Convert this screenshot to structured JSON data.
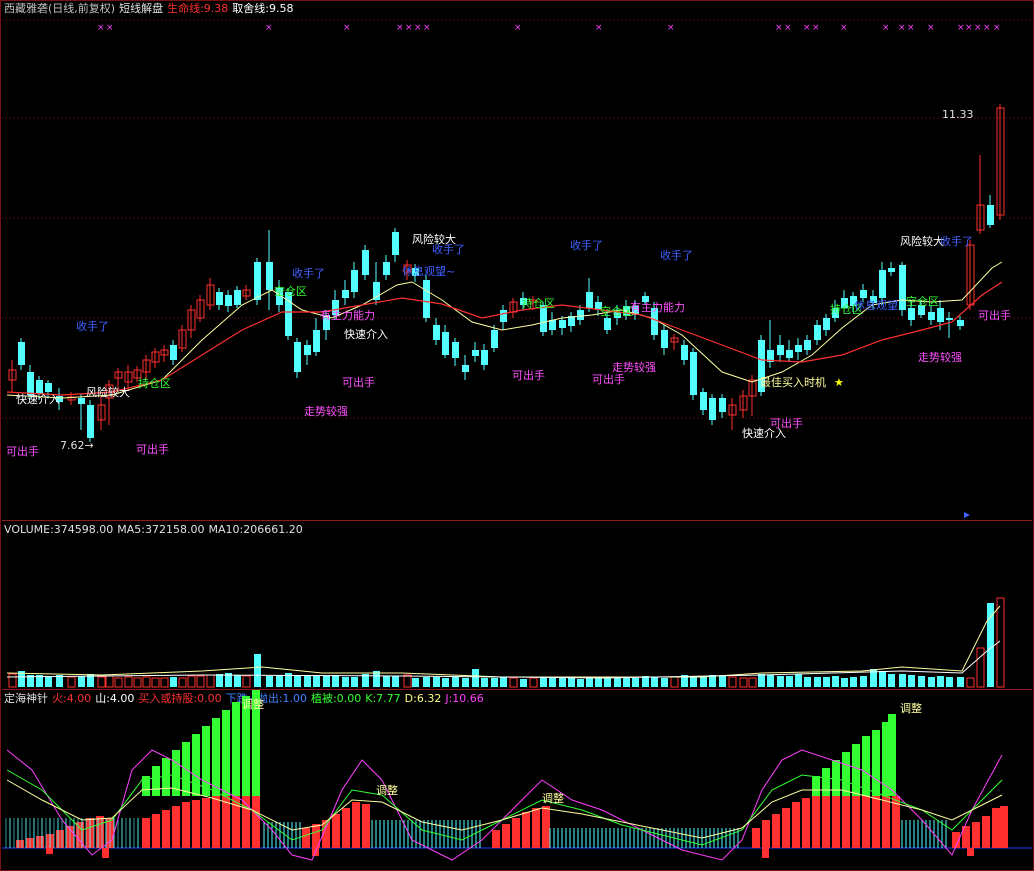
{
  "price_header": {
    "title": "西藏雅砻(日线,前复权)",
    "indicator": "短线解盘",
    "lifeline_label": "生命线:9.38",
    "exitline_label": "取舍线:9.58",
    "title_color": "#c0c0c0",
    "lifeline_color": "#ff3030",
    "exitline_color": "#ffffff"
  },
  "price_labels": {
    "high_marker": "11.33",
    "low_marker": "7.62→",
    "fast_entry": "快速介入",
    "risk_high": "风险较大",
    "take_profit": "收手了",
    "sellable": "可出手",
    "strong_trend": "走势较强",
    "hold_zone": "持仓区",
    "empty_zone": "空仓区",
    "wait_see": "休息观望~",
    "main_power": "有主力能力",
    "best_buy": "最佳买入时机",
    "best_buy_star": "★",
    "wait_see_b": "休息观望"
  },
  "volume_header": {
    "volume": "VOLUME:374598.00",
    "ma5": "MA5:372158.00",
    "ma10": "MA10:206661.20"
  },
  "osc_header": {
    "name": "定海神针",
    "fire": "火:4.00",
    "mountain": "山:4.00",
    "buy_hold": "买入或持股:0.00",
    "down_sell": "下跌→抛出:1.00",
    "plant": "植被:0.00",
    "k": "K:7.77",
    "d": "D:6.32",
    "j": "J:10.66"
  },
  "osc_labels": {
    "adjust": "调整"
  },
  "colors": {
    "up": "#ff3030",
    "down": "#54ffff",
    "ma_white": "#ffffa0",
    "ma_red": "#ff2020",
    "green_bar": "#33ff33",
    "magenta": "#ff40ff",
    "blue_text": "#4060ff",
    "pink_text": "#ff50ff"
  },
  "chart_data": {
    "type": "candlestick",
    "symbol": "西藏雅砻",
    "period": "日线",
    "high_label": 11.33,
    "low_label": 7.62
  }
}
